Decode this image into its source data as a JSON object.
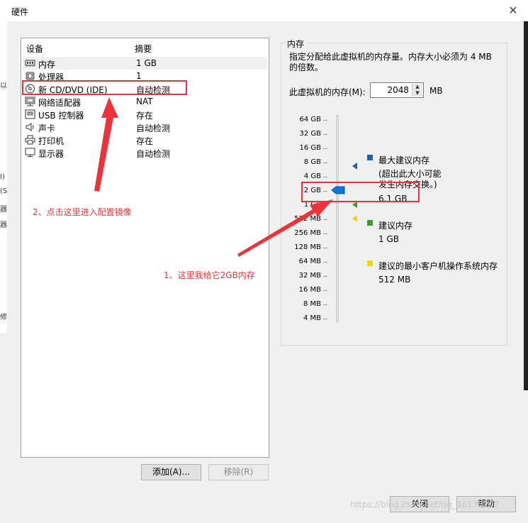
{
  "window": {
    "title": "硬件",
    "close_glyph": "✕"
  },
  "background": {
    "left_chars": [
      "以",
      "I)",
      "(S",
      "器",
      "器",
      "修"
    ]
  },
  "devices": {
    "header_device": "设备",
    "header_summary": "摘要",
    "rows": [
      {
        "name": "内存",
        "summary": "1 GB",
        "icon": "memory-icon"
      },
      {
        "name": "处理器",
        "summary": "1",
        "icon": "cpu-icon"
      },
      {
        "name": "新 CD/DVD (IDE)",
        "summary": "自动检测",
        "icon": "cd-dvd-icon"
      },
      {
        "name": "网络适配器",
        "summary": "NAT",
        "icon": "network-adapter-icon"
      },
      {
        "name": "USB 控制器",
        "summary": "存在",
        "icon": "usb-icon"
      },
      {
        "name": "声卡",
        "summary": "自动检测",
        "icon": "sound-icon"
      },
      {
        "name": "打印机",
        "summary": "存在",
        "icon": "printer-icon"
      },
      {
        "name": "显示器",
        "summary": "自动检测",
        "icon": "display-icon"
      }
    ],
    "add_label": "添加(A)...",
    "remove_label": "移除(R)"
  },
  "memory": {
    "legend": "内存",
    "description": "指定分配给此虚拟机的内存量。内存大小必须为 4 MB 的倍数。",
    "vm_memory_label": "此虚拟机的内存(M):",
    "value": "2048",
    "unit": "MB",
    "ticks": [
      "64 GB",
      "32 GB",
      "16 GB",
      "8 GB",
      "4 GB",
      "2 GB",
      "1 GB",
      "512 MB",
      "256 MB",
      "128 MB",
      "64 MB",
      "32 MB",
      "16 MB",
      "8 MB",
      "4 MB"
    ],
    "legend_max_title": "最大建议内存",
    "legend_max_note": "(超出此大小可能发生内存交换。)",
    "legend_max_value": "6.1 GB",
    "legend_rec_title": "建议内存",
    "legend_rec_value": "1 GB",
    "legend_min_title": "建议的最小客户机操作系统内存",
    "legend_min_value": "512 MB",
    "colors": {
      "max": "#1a63b3",
      "recommended": "#3c9b25",
      "minimum": "#f2d40a"
    }
  },
  "annotations": {
    "step1": "1、这里我给它2GB内存",
    "step2": "2、点击这里进入配置镜像",
    "color": "#e8343a"
  },
  "footer": {
    "close_label": "关闭",
    "help_label": "帮助"
  },
  "watermark": "https://blog.csdn.net/qq_46138207"
}
